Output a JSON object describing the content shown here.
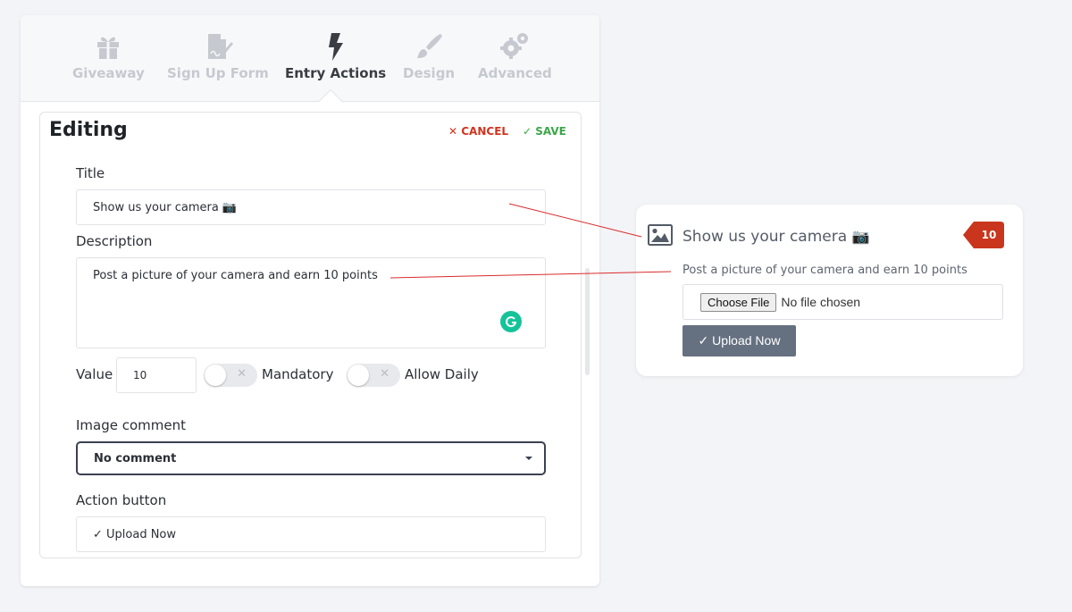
{
  "tabs": [
    {
      "label": "Giveaway",
      "icon": "gift-icon",
      "active": false
    },
    {
      "label": "Sign Up Form",
      "icon": "signup-form-icon",
      "active": false
    },
    {
      "label": "Entry Actions",
      "icon": "bolt-icon",
      "active": true
    },
    {
      "label": "Design",
      "icon": "brush-icon",
      "active": false
    },
    {
      "label": "Advanced",
      "icon": "gears-icon",
      "active": false
    }
  ],
  "editor": {
    "heading": "Editing",
    "cancel_label": "CANCEL",
    "save_label": "SAVE",
    "title_label": "Title",
    "title_value": "Show us your camera  📷",
    "description_label": "Description",
    "description_value": "Post a picture of your  camera and earn 10 points",
    "value_label": "Value",
    "value_value": "10",
    "mandatory_label": "Mandatory",
    "mandatory_on": false,
    "allow_daily_label": "Allow Daily",
    "allow_daily_on": false,
    "image_comment_label": "Image comment",
    "image_comment_value": "No comment",
    "action_button_label": "Action button",
    "action_button_value": "✓ Upload Now"
  },
  "preview": {
    "icon": "image-icon",
    "title": "Show us your camera",
    "camera_emoji": "📷",
    "points": "10",
    "description": "Post a picture of your camera and earn 10 points",
    "choose_file_label": "Choose File",
    "no_file_text": "No file chosen",
    "upload_label": "✓ Upload Now"
  },
  "colors": {
    "cancel": "#d0341f",
    "save": "#3fa64a",
    "badge": "#c9361d",
    "upload_button": "#657080",
    "connector": "#d92b2b"
  }
}
